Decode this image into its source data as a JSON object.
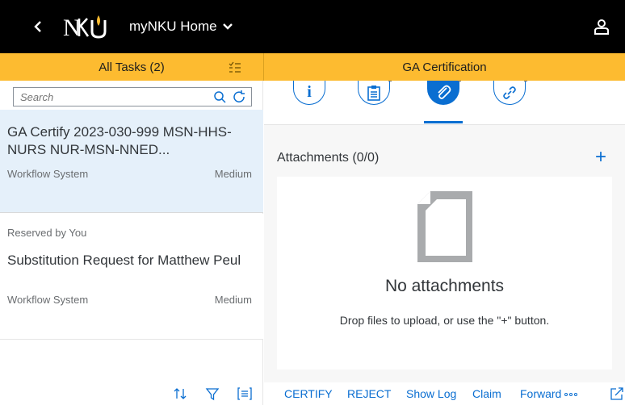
{
  "shell": {
    "logo_text": "NKU",
    "app_title": "myNKU Home"
  },
  "master": {
    "title": "All Tasks (2)",
    "search_placeholder": "Search",
    "items": [
      {
        "title": "GA Certify 2023-030-999 MSN-HHS-NURS NUR-MSN-NNED...",
        "source": "Workflow System",
        "priority": "Medium"
      },
      {
        "status": "Reserved by You",
        "title": "Substitution Request for Matthew Peul",
        "source": "Workflow System",
        "priority": "Medium"
      }
    ]
  },
  "detail": {
    "title": "GA Certification",
    "tabs": [
      {
        "icon": "info-icon"
      },
      {
        "icon": "clipboard-icon"
      },
      {
        "icon": "paperclip-icon",
        "selected": true
      },
      {
        "icon": "link-icon"
      }
    ],
    "attachments": {
      "title": "Attachments (0/0)",
      "add_label": "+",
      "empty_title": "No attachments",
      "empty_hint": "Drop files to upload, or use the \"+\" button."
    },
    "footer": {
      "certify": "CERTIFY",
      "reject": "REJECT",
      "show_log": "Show Log",
      "claim": "Claim",
      "forward": "Forward"
    }
  },
  "colors": {
    "shellbar": "#000000",
    "header": "#fdbb30",
    "accent": "#0a6ed1",
    "selected_item": "#e5f0fa"
  }
}
